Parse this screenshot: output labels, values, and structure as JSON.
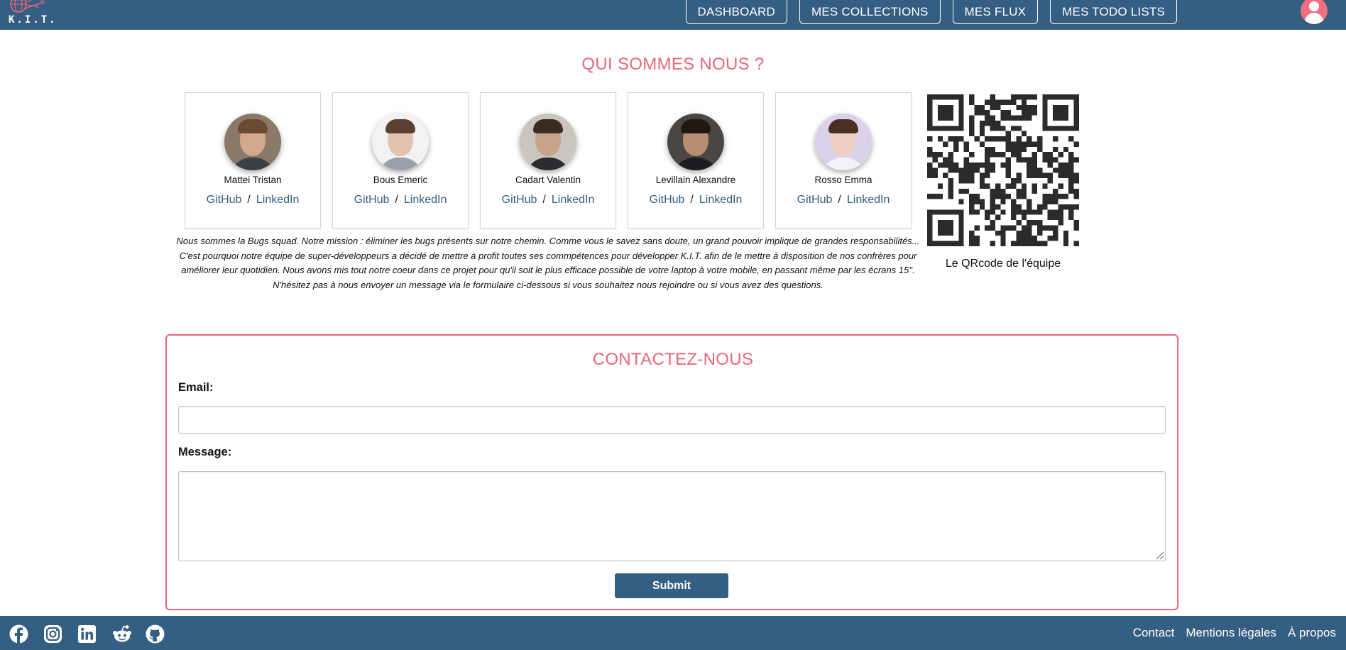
{
  "header": {
    "logo_text": "K.I.T.",
    "nav": [
      "DASHBOARD",
      "MES COLLECTIONS",
      "MES FLUX",
      "MES TODO LISTS"
    ],
    "user_icon": "user-circle-icon"
  },
  "about": {
    "title": "QUI SOMMES NOUS ?",
    "members": [
      {
        "name": "Mattei Tristan",
        "github": "GitHub",
        "linkedin": "LinkedIn"
      },
      {
        "name": "Bous Emeric",
        "github": "GitHub",
        "linkedin": "LinkedIn"
      },
      {
        "name": "Cadart Valentin",
        "github": "GitHub",
        "linkedin": "LinkedIn"
      },
      {
        "name": "Levillain Alexandre",
        "github": "GitHub",
        "linkedin": "LinkedIn"
      },
      {
        "name": "Rosso Emma",
        "github": "GitHub",
        "linkedin": "LinkedIn"
      }
    ],
    "link_separator": "/",
    "mission": "Nous sommes la Bugs squad. Notre mission : éliminer les bugs présents sur notre chemin. Comme vous le savez sans doute, un grand pouvoir implique de grandes responsabilités... C'est pourquoi notre équipe de super-développeurs a décidé de mettre à profit toutes ses commpétences pour développer K.I.T. afin de le mettre à disposition de nos confrères pour améliorer leur quotidien. Nous avons mis tout notre coeur dans ce projet pour qu'il soit le plus efficace possible de votre laptop à votre mobile, en passant même par les écrans 15''. N'hésitez pas à nous envoyer un message via le formulaire ci-dessous si vous souhaitez nous rejoindre ou si vous avez des questions.",
    "qr_caption": "Le QRcode de l'équipe"
  },
  "contact": {
    "title": "CONTACTEZ-NOUS",
    "email_label": "Email:",
    "email_value": "",
    "message_label": "Message:",
    "message_value": "",
    "submit_label": "Submit"
  },
  "footer": {
    "social_icons": [
      "facebook-icon",
      "instagram-icon",
      "linkedin-icon",
      "reddit-icon",
      "github-icon"
    ],
    "links": [
      "Contact",
      "Mentions légales",
      "À propos"
    ]
  },
  "colors": {
    "primary": "#345e82",
    "accent": "#e96779",
    "background": "#ffffff"
  }
}
